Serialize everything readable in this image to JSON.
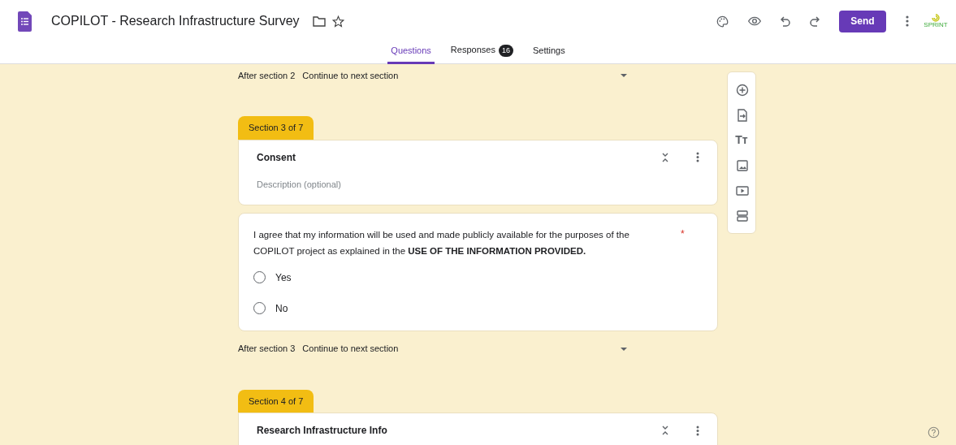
{
  "header": {
    "title": "COPILOT - Research Infrastructure Survey",
    "send_label": "Send",
    "logo_text": "SPRINT"
  },
  "tabs": [
    {
      "label": "Questions",
      "selected": true
    },
    {
      "label": "Responses",
      "badge": "16",
      "selected": false
    },
    {
      "label": "Settings",
      "selected": false
    }
  ],
  "blocks": [
    {
      "kind": "after",
      "label": "After section 2",
      "value": "Continue to next section"
    },
    {
      "kind": "section",
      "tab": "Section 3 of 7",
      "title": "Consent",
      "placeholder": "Description (optional)"
    },
    {
      "kind": "question",
      "text": "I agree that my information will be used and made publicly available for the purposes of the COPILOT project as explained in the  **USE OF THE INFORMATION PROVIDED.**",
      "required": true,
      "required_mark": "*",
      "options": [
        {
          "label": "Yes",
          "selected": false
        },
        {
          "label": "No",
          "selected": false
        }
      ]
    },
    {
      "kind": "after",
      "label": "After section 3",
      "value": "Continue to next section"
    },
    {
      "kind": "section",
      "tab": "Section 4 of 7",
      "title": "Research Infrastructure Info"
    }
  ],
  "toolbar": [
    {
      "kind": "add"
    },
    {
      "kind": "import"
    },
    {
      "kind": "title",
      "glyph": "Tт"
    },
    {
      "kind": "image"
    },
    {
      "kind": "video"
    },
    {
      "kind": "section"
    }
  ]
}
